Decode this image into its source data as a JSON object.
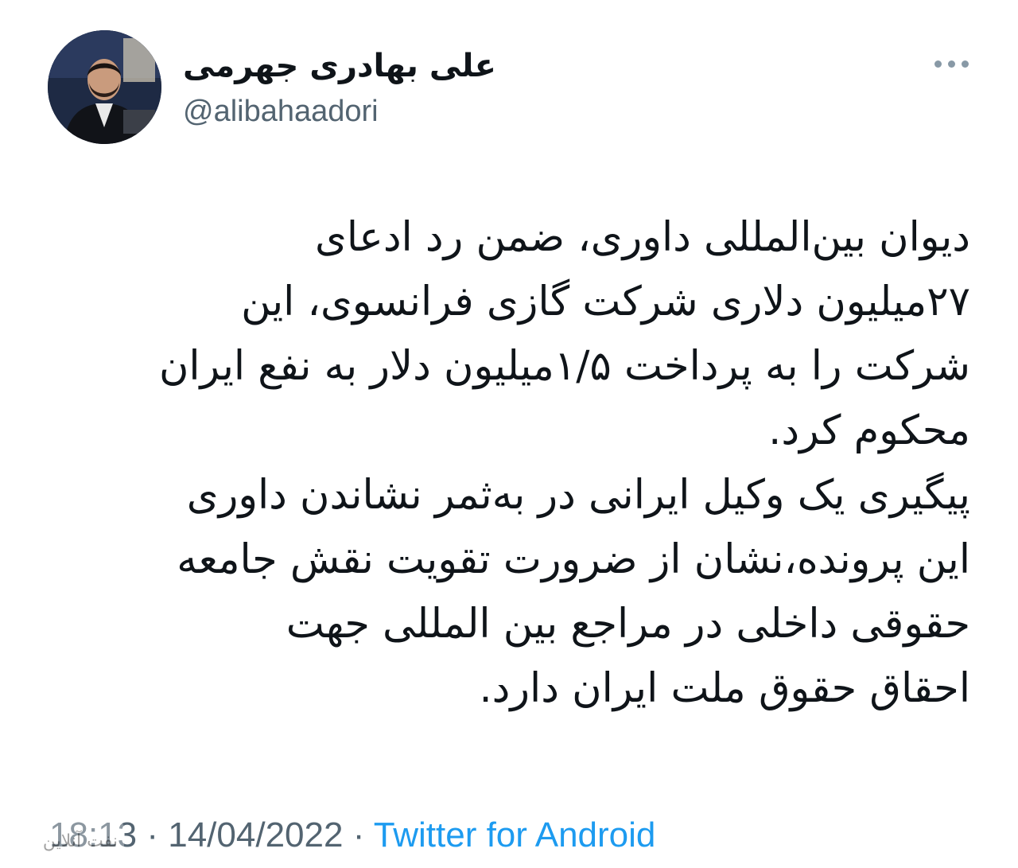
{
  "author": {
    "display_name": "علی بهادری جهرمی",
    "username": "@alibahaadori",
    "avatar_icon": "profile-photo"
  },
  "tweet": {
    "lines": [
      "دیوان بین‌المللی داوری، ضمن رد ادعای",
      "۲۷میلیون دلاری شرکت گازی فرانسوی، این",
      "شرکت را به پرداخت ۱/۵میلیون دلار به نفع ایران",
      "محکوم کرد.",
      "پیگیری یک وکیل ایرانی در به‌ثمر نشاندن داوری",
      "این پرونده،نشان از ضرورت تقویت نقش جامعه",
      "حقوقی داخلی در مراجع بین المللی جهت",
      "احقاق حقوق ملت ایران دارد."
    ]
  },
  "meta": {
    "time": "18:13",
    "separator": "·",
    "date": "14/04/2022",
    "source": "Twitter for Android"
  },
  "more_icon": "more-horizontal-icon",
  "watermark_text": "نفت آنلاین",
  "colors": {
    "text": "#0f1419",
    "secondary": "#536471",
    "link": "#1d9bf0"
  }
}
